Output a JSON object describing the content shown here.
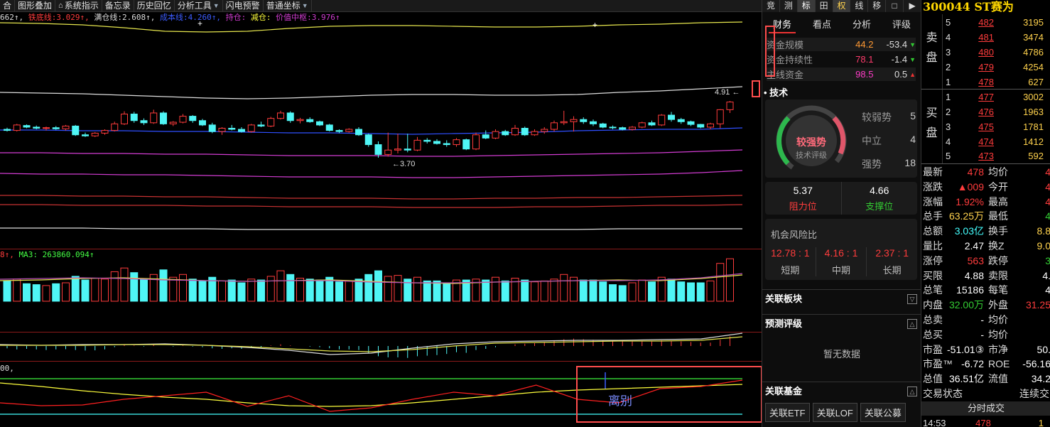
{
  "toolbar": {
    "items": [
      "合",
      "图形叠加",
      "系统指示",
      "备忘录",
      "历史回忆",
      "分析工具",
      "闪电预警",
      "普通坐标"
    ]
  },
  "indicator_line": {
    "prefix": "662↑,",
    "tie_di_label": "铁底线:",
    "tie_di_value": "3.029↑,",
    "man_cang_label": "满仓线:",
    "man_cang_value": "2.608↑,",
    "cheng_ben_label": "成本线:",
    "cheng_ben_value": "4.260↑,",
    "chi_cang_label": "持仓:",
    "jian_cang_label": "减仓:",
    "jia_zhi_label": "价值中枢:",
    "jia_zhi_value": "3.976↑"
  },
  "main_chart": {
    "high_label": "4.91",
    "low_label": "3.70",
    "vol_header_prefix": "8↑,",
    "vol_header": "MA3: 263860.094↑",
    "osc_header": "00,",
    "divergence_label": "离别",
    "candles": [
      [
        4.22,
        4.25,
        4.18,
        4.2
      ],
      [
        4.2,
        4.32,
        4.18,
        4.3
      ],
      [
        4.29,
        4.31,
        4.24,
        4.26
      ],
      [
        4.26,
        4.29,
        4.22,
        4.24
      ],
      [
        4.24,
        4.27,
        4.2,
        4.25
      ],
      [
        4.25,
        4.28,
        4.21,
        4.23
      ],
      [
        4.23,
        4.3,
        4.2,
        4.28
      ],
      [
        4.28,
        4.3,
        4.1,
        4.12
      ],
      [
        4.12,
        4.16,
        4.08,
        4.1
      ],
      [
        4.1,
        4.17,
        4.08,
        4.15
      ],
      [
        4.15,
        4.22,
        4.12,
        4.2
      ],
      [
        4.2,
        4.36,
        4.18,
        4.32
      ],
      [
        4.32,
        4.55,
        4.3,
        4.5
      ],
      [
        4.5,
        4.54,
        4.34,
        4.38
      ],
      [
        4.38,
        4.42,
        4.3,
        4.34
      ],
      [
        4.34,
        4.58,
        4.32,
        4.52
      ],
      [
        4.52,
        4.55,
        4.3,
        4.32
      ],
      [
        4.32,
        4.37,
        4.28,
        4.35
      ],
      [
        4.35,
        4.5,
        4.33,
        4.46
      ],
      [
        4.46,
        4.48,
        4.34,
        4.38
      ],
      [
        4.38,
        4.41,
        4.28,
        4.3
      ],
      [
        4.3,
        4.34,
        4.15,
        4.18
      ],
      [
        4.18,
        4.26,
        4.12,
        4.24
      ],
      [
        4.24,
        4.3,
        4.2,
        4.22
      ],
      [
        4.22,
        4.26,
        4.16,
        4.18
      ],
      [
        4.18,
        4.32,
        4.16,
        4.3
      ],
      [
        4.3,
        4.36,
        4.26,
        4.28
      ],
      [
        4.28,
        4.45,
        4.26,
        4.42
      ],
      [
        4.42,
        4.56,
        4.4,
        4.52
      ],
      [
        4.52,
        4.55,
        4.34,
        4.38
      ],
      [
        4.38,
        4.43,
        4.33,
        4.4
      ],
      [
        4.4,
        4.44,
        4.34,
        4.36
      ],
      [
        4.36,
        4.38,
        4.28,
        4.3
      ],
      [
        4.3,
        4.32,
        4.18,
        4.2
      ],
      [
        4.2,
        4.22,
        4.15,
        4.18
      ],
      [
        4.18,
        4.24,
        4.16,
        4.22
      ],
      [
        4.22,
        4.26,
        4.1,
        4.12
      ],
      [
        4.12,
        4.14,
        3.9,
        3.94
      ],
      [
        3.94,
        4.0,
        3.7,
        3.76
      ],
      [
        3.76,
        4.16,
        3.72,
        3.84
      ],
      [
        3.84,
        4.14,
        3.78,
        3.86
      ],
      [
        3.86,
        4.14,
        3.8,
        3.84
      ],
      [
        3.84,
        4.08,
        3.82,
        4.02
      ],
      [
        4.02,
        4.06,
        3.96,
        4.0
      ],
      [
        4.0,
        4.04,
        3.94,
        3.96
      ],
      [
        3.96,
        4.02,
        3.9,
        3.94
      ],
      [
        3.94,
        4.06,
        3.9,
        4.03
      ],
      [
        4.03,
        4.05,
        3.84,
        3.86
      ],
      [
        3.86,
        4.16,
        3.84,
        4.12
      ],
      [
        4.12,
        4.2,
        4.04,
        4.06
      ],
      [
        4.06,
        4.22,
        4.04,
        4.18
      ],
      [
        4.18,
        4.21,
        4.1,
        4.12
      ],
      [
        4.12,
        4.3,
        4.1,
        4.24
      ],
      [
        4.24,
        4.27,
        4.1,
        4.12
      ],
      [
        4.12,
        4.22,
        4.1,
        4.18
      ],
      [
        4.18,
        4.26,
        4.14,
        4.22
      ],
      [
        4.22,
        4.38,
        4.18,
        4.34
      ],
      [
        4.34,
        4.56,
        4.3,
        4.36
      ],
      [
        4.36,
        4.46,
        4.18,
        4.4
      ],
      [
        4.4,
        4.44,
        4.32,
        4.36
      ],
      [
        4.36,
        4.4,
        4.28,
        4.32
      ],
      [
        4.32,
        4.34,
        4.24,
        4.26
      ],
      [
        4.26,
        4.29,
        4.22,
        4.25
      ],
      [
        4.25,
        4.27,
        4.2,
        4.22
      ],
      [
        4.22,
        4.28,
        4.2,
        4.26
      ],
      [
        4.26,
        4.36,
        4.24,
        4.34
      ],
      [
        4.34,
        4.38,
        4.28,
        4.3
      ],
      [
        4.3,
        4.5,
        4.28,
        4.48
      ],
      [
        4.48,
        4.54,
        4.36,
        4.4
      ],
      [
        4.4,
        4.43,
        4.32,
        4.36
      ],
      [
        4.36,
        4.38,
        4.28,
        4.31
      ],
      [
        4.31,
        4.32,
        4.24,
        4.26
      ],
      [
        4.26,
        4.34,
        4.22,
        4.32
      ],
      [
        4.32,
        4.59,
        4.24,
        4.58
      ],
      [
        4.58,
        4.74,
        4.52,
        4.72
      ]
    ],
    "volume": [
      2.2,
      2.4,
      1.9,
      1.8,
      1.7,
      1.9,
      2.0,
      2.7,
      2.3,
      2.5,
      2.4,
      3.2,
      3.6,
      3.1,
      2.4,
      2.9,
      3.4,
      2.6,
      2.9,
      2.4,
      2.2,
      2.6,
      2.2,
      2.3,
      2.0,
      2.4,
      2.3,
      2.7,
      3.3,
      2.9,
      2.5,
      2.4,
      2.3,
      2.6,
      2.1,
      2.2,
      2.4,
      2.9,
      3.3,
      2.7,
      2.8,
      2.4,
      2.6,
      2.2,
      2.2,
      2.0,
      2.3,
      2.3,
      2.4,
      2.3,
      2.6,
      2.2,
      2.5,
      2.3,
      2.1,
      2.2,
      2.4,
      2.9,
      2.6,
      2.3,
      2.3,
      2.1,
      1.8,
      1.7,
      2.0,
      2.3,
      2.1,
      2.6,
      2.4,
      2.1,
      2.0,
      2.0,
      2.2,
      4.1,
      4.6
    ],
    "macd": [
      -0.2,
      -0.3,
      -0.25,
      -0.3,
      -0.35,
      -0.3,
      -0.28,
      -0.35,
      -0.4,
      -0.38,
      -0.3,
      -0.1,
      0.1,
      0.05,
      -0.05,
      0.1,
      0.0,
      -0.05,
      0.05,
      -0.05,
      -0.1,
      -0.2,
      -0.25,
      -0.2,
      -0.25,
      -0.15,
      -0.1,
      0.05,
      0.15,
      0.05,
      0.0,
      -0.05,
      -0.1,
      -0.2,
      -0.3,
      -0.3,
      -0.35,
      -0.6,
      -0.9,
      -1.0,
      -1.0,
      -1.05,
      -0.9,
      -0.85,
      -0.8,
      -0.7,
      -0.55,
      -0.6,
      -0.35,
      -0.25,
      -0.1,
      0.0,
      0.15,
      0.2,
      0.25,
      0.35,
      0.45,
      0.6,
      0.65,
      0.6,
      0.55,
      0.5,
      0.45,
      0.4,
      0.4,
      0.45,
      0.4,
      0.5,
      0.45,
      0.4,
      0.35,
      0.3,
      0.3,
      0.55,
      0.85
    ]
  },
  "panel_mid": {
    "top_buttons": [
      "竞",
      "测",
      "标",
      "田",
      "权",
      "线",
      "移",
      "□",
      "▶"
    ],
    "fin_tabs": [
      "财务",
      "看点",
      "分析",
      "评级"
    ],
    "fund_rows": [
      {
        "label": "资金规模",
        "v1": "44.2",
        "v2": "-53.4",
        "dir": "down"
      },
      {
        "label": "资金持续性",
        "v1": "78.1",
        "v2": "-1.4",
        "dir": "down"
      },
      {
        "label": "主线资金",
        "v1": "98.5",
        "v2": "0.5",
        "dir": "up"
      }
    ],
    "tech_title": "技术",
    "gauge_main": "较强势",
    "gauge_sub": "技术评级",
    "gauge_levels": [
      {
        "label": "较弱势",
        "value": "5"
      },
      {
        "label": "中立",
        "value": "4"
      },
      {
        "label": "强势",
        "value": "18"
      }
    ],
    "resist_value": "5.37",
    "resist_label": "阻力位",
    "support_value": "4.66",
    "support_label": "支撑位",
    "risk_title": "机会风险比",
    "risk": [
      {
        "value": "12.78 : 1",
        "label": "短期"
      },
      {
        "value": "4.16 : 1",
        "label": "中期"
      },
      {
        "value": "2.37 : 1",
        "label": "长期"
      }
    ],
    "related_sector": "关联板块",
    "forecast_title": "预测评级",
    "forecast_empty": "暂无数据",
    "related_fund": "关联基金",
    "fund_buttons": [
      "关联ETF",
      "关联LOF",
      "关联公募"
    ]
  },
  "panel_right": {
    "code": "300044",
    "name": "ST赛为",
    "sell_label": [
      "卖",
      "盘"
    ],
    "buy_label": [
      "买",
      "盘"
    ],
    "sell": [
      {
        "lv": "5",
        "price": "482",
        "vol": "3195"
      },
      {
        "lv": "4",
        "price": "481",
        "vol": "3474"
      },
      {
        "lv": "3",
        "price": "480",
        "vol": "4786"
      },
      {
        "lv": "2",
        "price": "479",
        "vol": "4254"
      },
      {
        "lv": "1",
        "price": "478",
        "vol": "627"
      }
    ],
    "buy": [
      {
        "lv": "1",
        "price": "477",
        "vol": "3002"
      },
      {
        "lv": "2",
        "price": "476",
        "vol": "1963"
      },
      {
        "lv": "3",
        "price": "475",
        "vol": "1781"
      },
      {
        "lv": "4",
        "price": "474",
        "vol": "1412"
      },
      {
        "lv": "5",
        "price": "473",
        "vol": "592"
      }
    ],
    "quotes": [
      {
        "l1": "最新",
        "v1": "478",
        "c1": "red",
        "l2": "均价",
        "v2": "4",
        "c2": "red"
      },
      {
        "l1": "涨跌",
        "v1": "▲009",
        "c1": "red",
        "l2": "今开",
        "v2": "4",
        "c2": "red"
      },
      {
        "l1": "涨幅",
        "v1": "1.92%",
        "c1": "red",
        "l2": "最高",
        "v2": "4",
        "c2": "red"
      },
      {
        "l1": "总手",
        "v1": "63.25万",
        "c1": "yel",
        "l2": "最低",
        "v2": "4",
        "c2": "green"
      },
      {
        "l1": "总额",
        "v1": "3.03亿",
        "c1": "cyan",
        "l2": "换手",
        "v2": "8.8",
        "c2": "yel"
      },
      {
        "l1": "量比",
        "v1": "2.47",
        "c1": "wht",
        "l2": "换Z",
        "v2": "9.0",
        "c2": "yel"
      },
      {
        "l1": "涨停",
        "v1": "563",
        "c1": "red",
        "l2": "跌停",
        "v2": "3",
        "c2": "green"
      },
      {
        "l1": "买限",
        "v1": "4.88",
        "c1": "wht",
        "l2": "卖限",
        "v2": "4.",
        "c2": "wht"
      },
      {
        "l1": "总笔",
        "v1": "15186",
        "c1": "wht",
        "l2": "每笔",
        "v2": "4",
        "c2": "wht"
      },
      {
        "l1": "内盘",
        "v1": "32.00万",
        "c1": "green",
        "l2": "外盘",
        "v2": "31.25",
        "c2": "red"
      },
      {
        "l1": "总卖",
        "v1": "-",
        "c1": "wht",
        "l2": "均价",
        "v2": "",
        "c2": "wht"
      },
      {
        "l1": "总买",
        "v1": "-",
        "c1": "wht",
        "l2": "均价",
        "v2": "",
        "c2": "wht"
      },
      {
        "l1": "市盈",
        "v1": "-51.01③",
        "c1": "wht",
        "l2": "市净",
        "v2": "50.",
        "c2": "wht"
      },
      {
        "l1": "市盈™",
        "v1": "-6.72",
        "c1": "wht",
        "l2": "ROE",
        "v2": "-56.16",
        "c2": "wht"
      },
      {
        "l1": "总值",
        "v1": "36.51亿",
        "c1": "wht",
        "l2": "流值",
        "v2": "34.2",
        "c2": "wht"
      }
    ],
    "trade_status_label": "交易状态",
    "trade_status_value": "连续交",
    "ticks_header": "分时成交",
    "tick_time": "14:53",
    "tick_price": "478",
    "tick_vol": "1"
  },
  "colors": {
    "rise": "#ff3c3c",
    "fall": "#4ff5f5",
    "ma_blue": "#2f4fff",
    "yellow": "#ffff3c",
    "magenta": "#d23cd2"
  }
}
